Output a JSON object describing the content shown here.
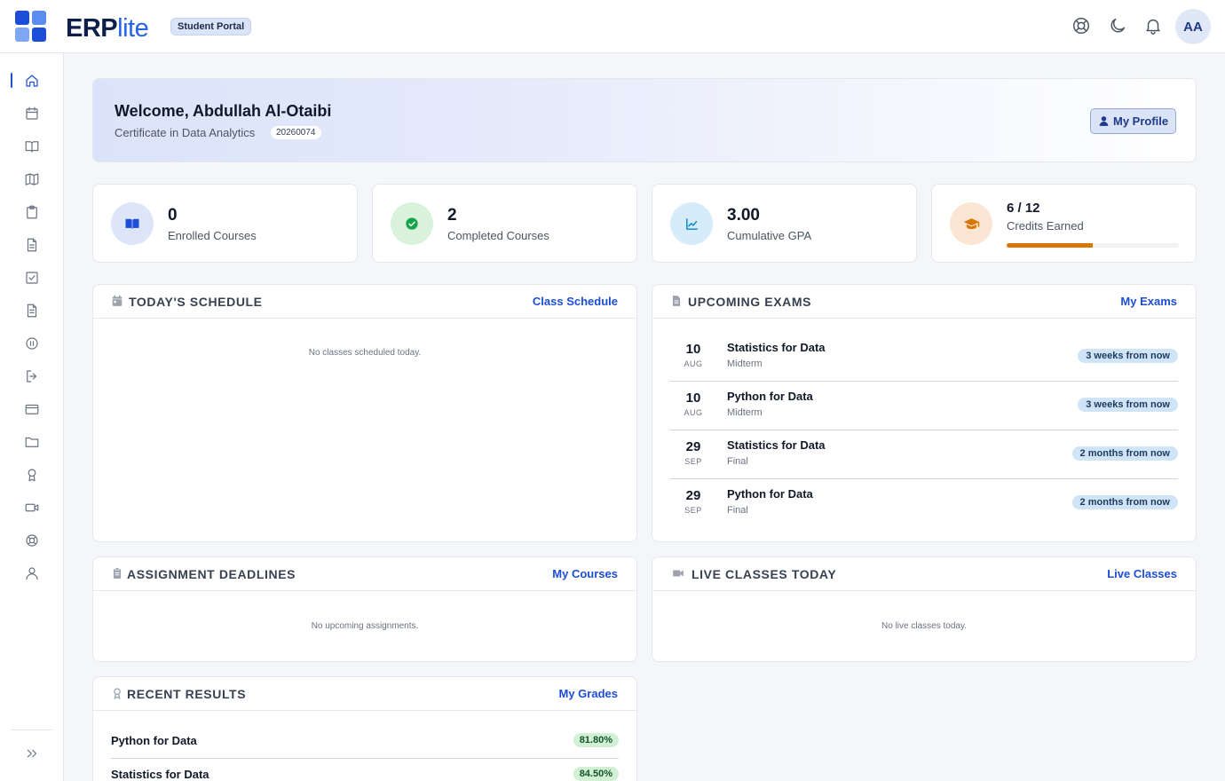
{
  "app": {
    "brand_main": "ERP",
    "brand_lite": "lite",
    "portal_badge": "Student Portal",
    "avatar_initials": "AA"
  },
  "sidebar": {
    "items": [
      "home-icon",
      "calendar-icon",
      "book-open-icon",
      "map-icon",
      "clipboard-icon",
      "file-text-icon",
      "check-square-icon",
      "file-icon",
      "pause-circle-icon",
      "log-out-icon",
      "credit-card-icon",
      "folder-icon",
      "award-icon",
      "video-icon",
      "life-buoy-icon",
      "user-icon"
    ],
    "active": "home-icon",
    "expand_icon": "chevrons-right-icon"
  },
  "welcome": {
    "greeting": "Welcome, Abdullah Al-Otaibi",
    "program": "Certificate in Data Analytics",
    "student_id": "20260074",
    "profile_button": "My Profile"
  },
  "stats": {
    "enrolled": {
      "value": "0",
      "label": "Enrolled Courses",
      "icon": "book-open-icon",
      "color": "#1d4ed8",
      "bg": "#dde5f8"
    },
    "completed": {
      "value": "2",
      "label": "Completed Courses",
      "icon": "check-circle-icon",
      "color": "#16a34a",
      "bg": "#d9f2dc"
    },
    "gpa": {
      "value": "3.00",
      "label": "Cumulative GPA",
      "icon": "trending-up-icon",
      "color": "#0284c7",
      "bg": "#d6ecfa"
    },
    "credits": {
      "value": "6 / 12",
      "label": "Credits Earned",
      "icon": "graduation-cap-icon",
      "color": "#d97706",
      "bg": "#fbe6d3",
      "progress": 0.5
    }
  },
  "schedule": {
    "title": "TODAY'S SCHEDULE",
    "link": "Class Schedule",
    "empty": "No classes scheduled today."
  },
  "exams": {
    "title": "UPCOMING EXAMS",
    "link": "My Exams",
    "rows": [
      {
        "day": "10",
        "month": "AUG",
        "course": "Statistics for Data",
        "type": "Midterm",
        "when": "3 weeks from now"
      },
      {
        "day": "10",
        "month": "AUG",
        "course": "Python for Data",
        "type": "Midterm",
        "when": "3 weeks from now"
      },
      {
        "day": "29",
        "month": "SEP",
        "course": "Statistics for Data",
        "type": "Final",
        "when": "2 months from now"
      },
      {
        "day": "29",
        "month": "SEP",
        "course": "Python for Data",
        "type": "Final",
        "when": "2 months from now"
      }
    ]
  },
  "assignments": {
    "title": "ASSIGNMENT DEADLINES",
    "link": "My Courses",
    "empty": "No upcoming assignments."
  },
  "live": {
    "title": "LIVE CLASSES TODAY",
    "link": "Live Classes",
    "empty": "No live classes today."
  },
  "results": {
    "title": "RECENT RESULTS",
    "link": "My Grades",
    "rows": [
      {
        "course": "Python for Data",
        "score": "81.80%"
      },
      {
        "course": "Statistics for Data",
        "score": "84.50%"
      }
    ]
  }
}
